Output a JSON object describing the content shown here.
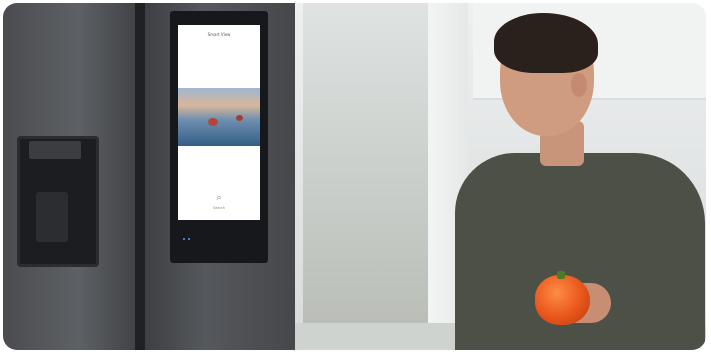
{
  "scene": {
    "subject": "photo",
    "screen": {
      "title": "Smart View",
      "caption": "Search"
    },
    "colors": {
      "fridge": "#4a4c50",
      "shirt": "#4d5046",
      "pepper": "#e8551b"
    }
  }
}
